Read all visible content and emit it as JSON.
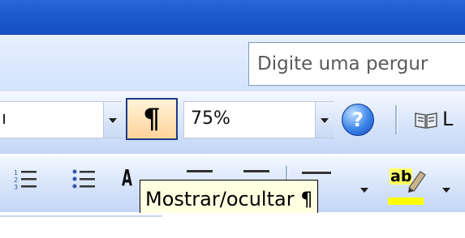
{
  "help": {
    "text": "Digite uma pergur"
  },
  "toolbar_standard": {
    "font_value": "ı",
    "zoom_value": "75%",
    "show_hide_glyph": "¶",
    "help_glyph": "?",
    "read_label": "L"
  },
  "toolbar_formatting": {
    "bold_glyph": "A",
    "highlight_label": "ab"
  },
  "tooltip": {
    "text": "Mostrar/ocultar ¶"
  },
  "colors": {
    "title_bar": "#1b5ad0",
    "button_hover": "#ffd39a",
    "highlight_bar": "#ffff00",
    "tooltip_bg": "#ffffe1"
  },
  "icons": [
    "show-hide-icon",
    "help-icon",
    "read-icon",
    "numbered-list-icon",
    "bulleted-list-icon",
    "highlight-icon"
  ]
}
